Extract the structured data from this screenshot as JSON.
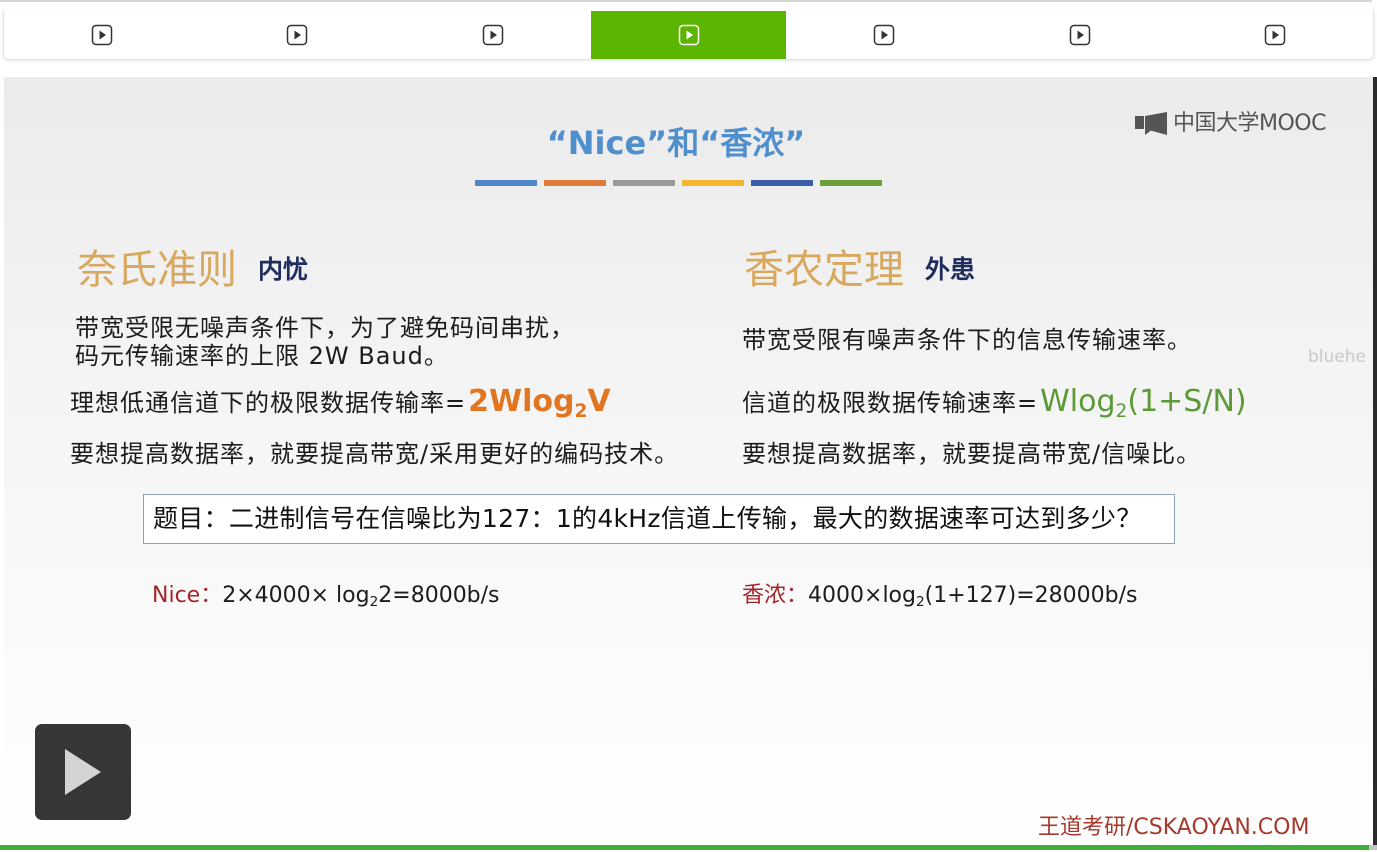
{
  "tabbar": {
    "active_index": 3,
    "tabs": [
      {
        "icon": "play-icon"
      },
      {
        "icon": "play-icon"
      },
      {
        "icon": "play-icon"
      },
      {
        "icon": "play-icon"
      },
      {
        "icon": "play-icon"
      },
      {
        "icon": "play-icon"
      },
      {
        "icon": "play-icon"
      }
    ]
  },
  "slide": {
    "logo": {
      "icon": "mooc-logo-icon",
      "text": "中国大学MOOC"
    },
    "title": "“Nice”和“香浓”",
    "title_bar_colors": [
      "#4f87c6",
      "#e07b39",
      "#9b9b9b",
      "#f2b630",
      "#3c5ea6",
      "#6a9f3c"
    ],
    "nyquist": {
      "heading": "奈氏准则",
      "tag": "内忧",
      "desc": [
        "带宽受限无噪声条件下，为了避免码间串扰，",
        "码元传输速率的上限 2W Baud。"
      ],
      "formula_label": "理想低通信道下的极限数据传输率=",
      "formula": {
        "main": "2Wlog",
        "sub": "2",
        "tail": "V"
      },
      "improve": "要想提高数据率，就要提高带宽/采用更好的编码技术。"
    },
    "shannon": {
      "heading": "香农定理",
      "tag": "外患",
      "desc": [
        "带宽受限有噪声条件下的信息传输速率。"
      ],
      "formula_label": "信道的极限数据传输速率=",
      "formula": {
        "main": "Wlog",
        "sub": "2",
        "tail": "(1+S/N)"
      },
      "improve": "要想提高数据率，就要提高带宽/信噪比。"
    },
    "watermark": "bluehe",
    "question": "题目：二进制信号在信噪比为127：1的4kHz信道上传输，最大的数据速率可达到多少？",
    "answers": {
      "nice": {
        "label": "Nice：",
        "main": "2×4000× log",
        "sub": "2",
        "tail": "2=8000b/s"
      },
      "shannon": {
        "label": "香浓：",
        "main": "4000×log",
        "sub": "2",
        "tail": "(1+127)=28000b/s"
      }
    },
    "footer_brand": "王道考研/CSKAOYAN.COM"
  },
  "player": {
    "play_icon": "play-icon",
    "progress": 0.994
  },
  "colors": {
    "title_blue": "#4f8fcd",
    "heading_gold": "#d8a85e",
    "tag_navy": "#1e2c5e",
    "formula_orange": "#e2751f",
    "formula_green": "#5b9a36",
    "answer_label_red": "#a3262b",
    "footer_red": "#a53a2c",
    "tab_active_green": "#5cb500",
    "progress_green": "#3fae3a"
  }
}
